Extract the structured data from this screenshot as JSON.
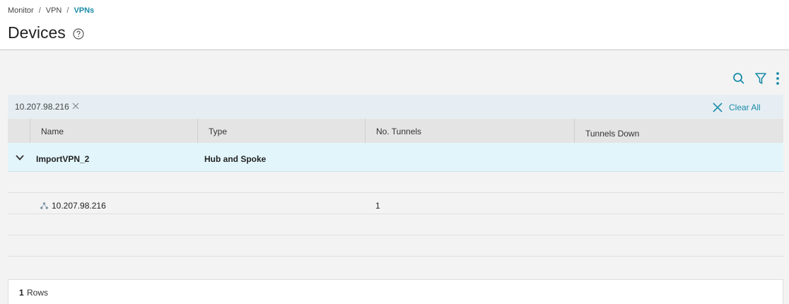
{
  "breadcrumb": {
    "items": [
      "Monitor",
      "VPN"
    ],
    "current": "VPNs",
    "separator": "/"
  },
  "page": {
    "title": "Devices"
  },
  "toolbar": {
    "search_icon": "search-icon",
    "filter_icon": "filter-icon",
    "more_icon": "kebab-menu-icon"
  },
  "filter": {
    "chip_label": "10.207.98.216",
    "clear_all_label": "Clear All"
  },
  "table": {
    "columns": [
      "Name",
      "Type",
      "No. Tunnels",
      "Tunnels Down"
    ],
    "groups": [
      {
        "name": "ImportVPN_2",
        "type": "Hub and Spoke",
        "rows": [
          {
            "name": "",
            "type": "",
            "tunnels": "",
            "down": ""
          },
          {
            "name": "10.207.98.216",
            "type": "",
            "tunnels": "1",
            "down": ""
          },
          {
            "name": "",
            "type": "",
            "tunnels": "",
            "down": ""
          },
          {
            "name": "",
            "type": "",
            "tunnels": "",
            "down": ""
          }
        ]
      }
    ]
  },
  "footer": {
    "count": "1",
    "rows_label": "Rows"
  },
  "colors": {
    "accent": "#1a8ba8",
    "group_row_bg": "#e2f5fb",
    "filter_bar_bg": "#e6eef3"
  }
}
